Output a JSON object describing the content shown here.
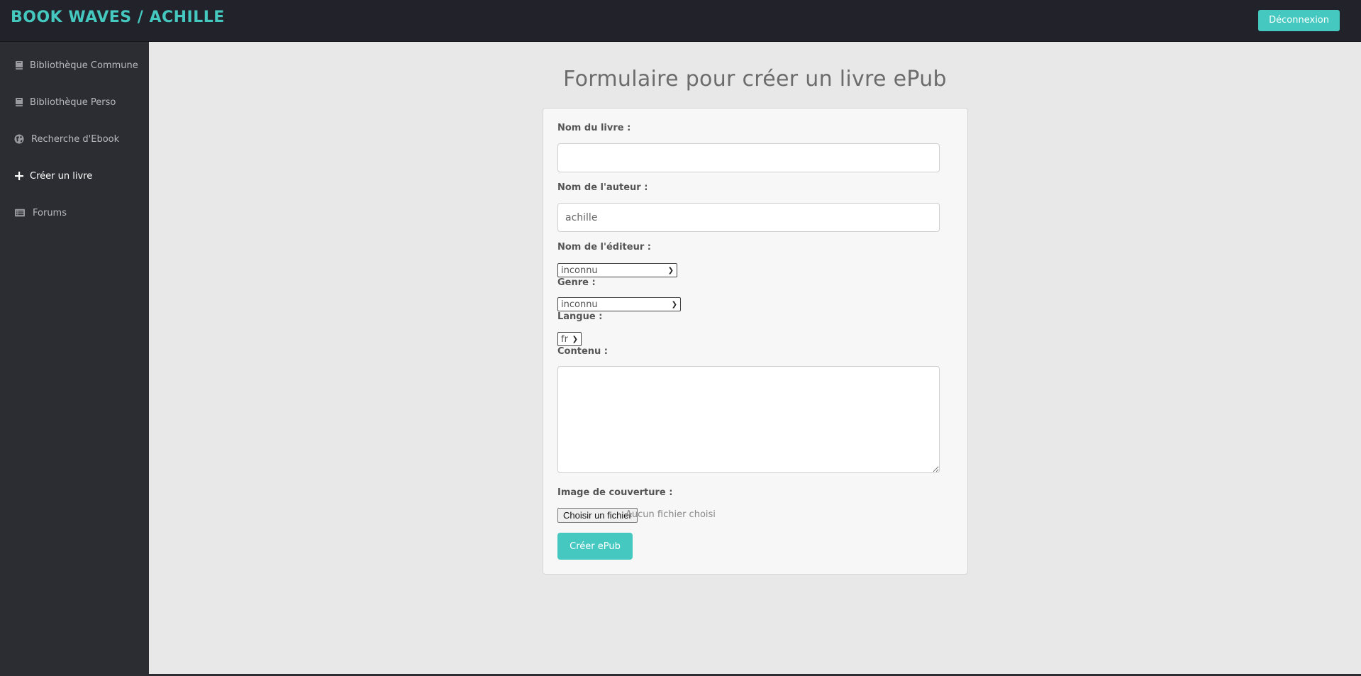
{
  "header": {
    "brand": "BOOK WAVES / ACHILLE",
    "logout_label": "Déconnexion"
  },
  "colors": {
    "accent": "#45c8c0",
    "topbar_bg": "#22232a",
    "sidebar_bg": "#2c2d33",
    "main_bg": "#e8e8e8"
  },
  "sidebar": {
    "items": [
      {
        "label": "Bibliothèque Commune",
        "icon": "book-icon",
        "active": false
      },
      {
        "label": "Bibliothèque Perso",
        "icon": "book-icon",
        "active": false
      },
      {
        "label": "Recherche d'Ebook",
        "icon": "globe-icon",
        "active": false
      },
      {
        "label": "Créer un livre",
        "icon": "plus-icon",
        "active": true
      },
      {
        "label": "Forums",
        "icon": "list-icon",
        "active": false
      }
    ]
  },
  "main": {
    "title": "Formulaire pour créer un livre ePub",
    "form": {
      "book_name_label": "Nom du livre :",
      "book_name_value": "",
      "author_label": "Nom de l'auteur :",
      "author_value": "achille",
      "publisher_label": "Nom de l'éditeur :",
      "publisher_value": "inconnu",
      "genre_label": "Genre :",
      "genre_value": "inconnu",
      "language_label": "Langue :",
      "language_value": "fr",
      "content_label": "Contenu :",
      "content_value": "",
      "cover_label": "Image de couverture :",
      "file_button_label": "Choisir un fichier",
      "file_status": "Aucun fichier choisi",
      "submit_label": "Créer ePub"
    }
  }
}
